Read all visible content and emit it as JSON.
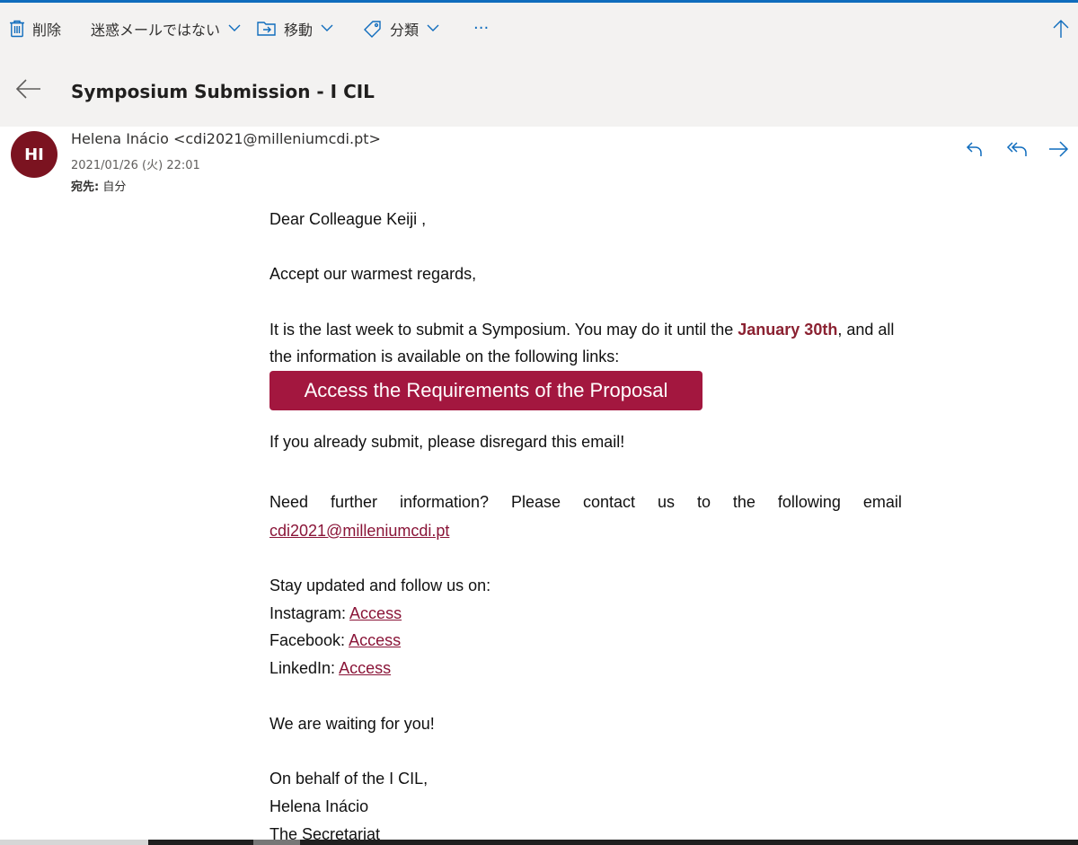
{
  "toolbar": {
    "delete": "削除",
    "not_junk": "迷惑メールではない",
    "move": "移動",
    "categorize": "分類",
    "more": "···"
  },
  "message": {
    "subject": "Symposium Submission - I CIL",
    "avatar_initials": "HI",
    "sender": "Helena Inácio <cdi2021@milleniumcdi.pt>",
    "date": "2021/01/26 (火) 22:01",
    "to_label": "宛先:",
    "to_value": "自分"
  },
  "body": {
    "greeting": "Dear Colleague  Keiji  ,",
    "regards": "Accept our warmest regards,",
    "para1_before": "It is the last week to submit a Symposium. You may do it until the ",
    "para1_highlight": "January 30th",
    "para1_after": ", and all",
    "para1_line2": "the information is available on the following links:",
    "button": "Access the Requirements of the Proposal",
    "already": "If you already submit, please disregard this email!",
    "need_words": [
      "Need",
      "further",
      "information?",
      "Please",
      "contact",
      "us",
      "to",
      "the",
      "following",
      "email"
    ],
    "email_link": "cdi2021@milleniumcdi.pt",
    "stay": "Stay updated and follow us on:",
    "instagram_label": "Instagram: ",
    "facebook_label": "Facebook: ",
    "linkedin_label": "LinkedIn: ",
    "access": "Access",
    "waiting": "We are waiting for you!",
    "behalf": "On behalf of the I CIL,",
    "signer": "Helena Inácio",
    "role": "The Secretariat"
  },
  "colors": {
    "accent": "#0f6cbd",
    "avatar": "#7b1320",
    "button": "#a3173f",
    "link": "#8a1538",
    "highlight": "#8b2232"
  },
  "icons": [
    "trash-icon",
    "chevron-down-icon",
    "move-folder-icon",
    "tag-icon",
    "up-arrow-icon",
    "back-arrow-icon",
    "reply-icon",
    "reply-all-icon",
    "forward-icon"
  ]
}
